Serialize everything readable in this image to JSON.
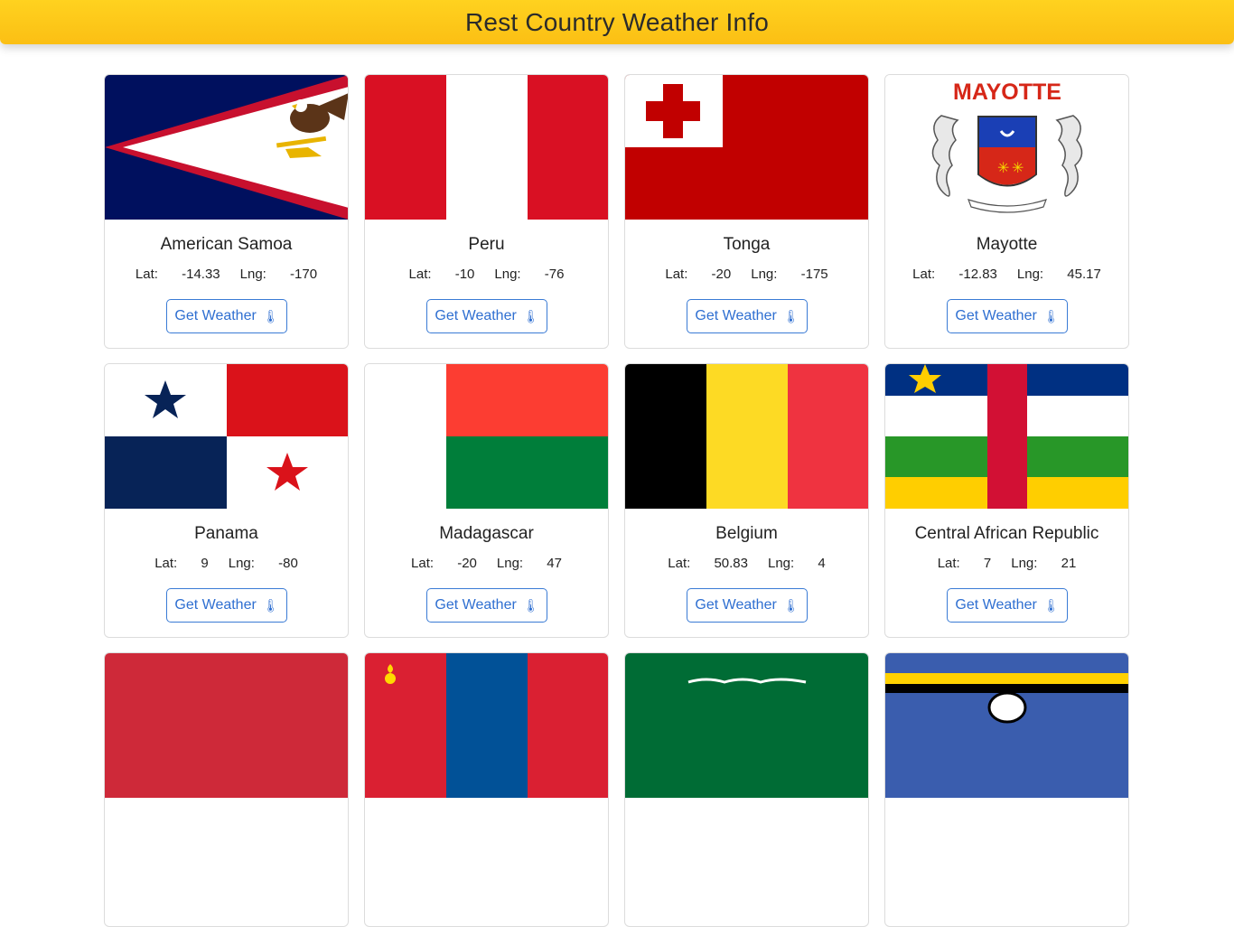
{
  "app": {
    "title": "Rest Country Weather Info"
  },
  "button_label": "Get Weather",
  "button_icon": "thermometer-icon",
  "lat_prefix": "Lat: ",
  "lng_prefix": "Lng: ",
  "countries": [
    {
      "name": "American Samoa",
      "lat": "-14.33",
      "lng": "-170"
    },
    {
      "name": "Peru",
      "lat": "-10",
      "lng": "-76"
    },
    {
      "name": "Tonga",
      "lat": "-20",
      "lng": "-175"
    },
    {
      "name": "Mayotte",
      "lat": "-12.83",
      "lng": "45.17"
    },
    {
      "name": "Panama",
      "lat": "9",
      "lng": "-80"
    },
    {
      "name": "Madagascar",
      "lat": "-20",
      "lng": "47"
    },
    {
      "name": "Belgium",
      "lat": "50.83",
      "lng": "4"
    },
    {
      "name": "Central African Republic",
      "lat": "7",
      "lng": "21"
    }
  ],
  "mayotte_flag_text": "MAYOTTE",
  "colors": {
    "header": "#fbbf14",
    "button": "#2f6fd1"
  }
}
